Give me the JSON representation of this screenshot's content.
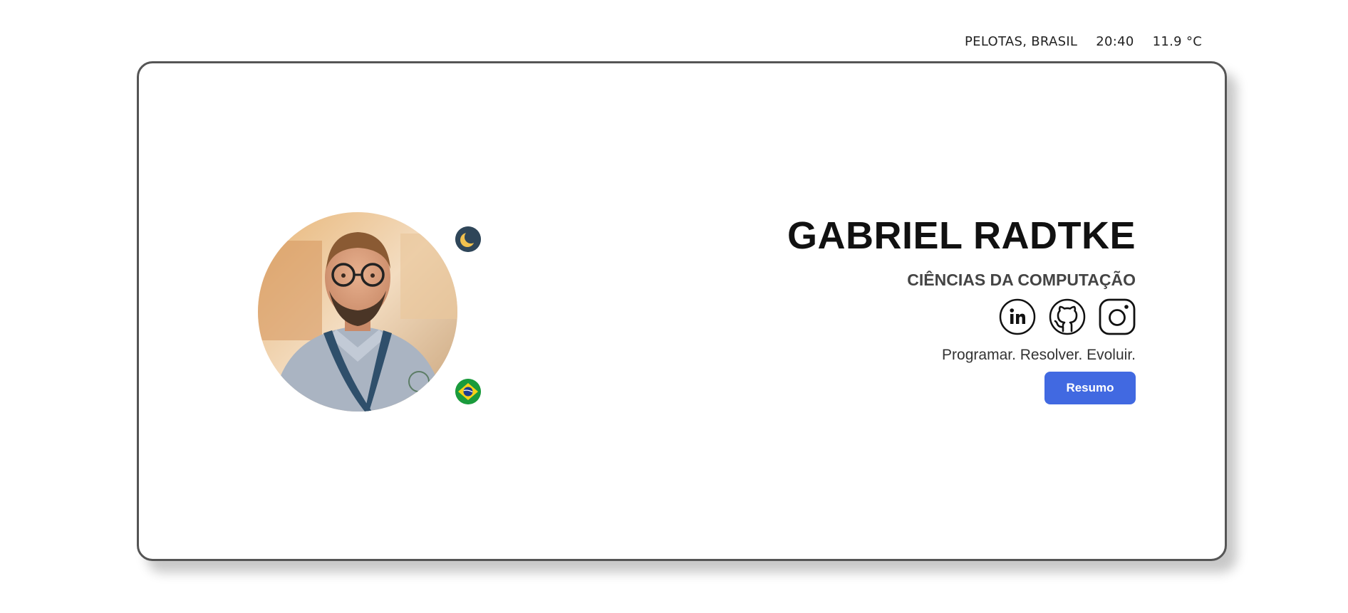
{
  "topbar": {
    "location": "PELOTAS, BRASIL",
    "time": "20:40",
    "temperature": "11.9 °C"
  },
  "profile": {
    "name": "GABRIEL RADTKE",
    "subtitle": "CIÊNCIAS DA COMPUTAÇÃO",
    "tagline": "Programar. Resolver. Evoluir.",
    "resume_label": "Resumo"
  },
  "socials": [
    {
      "icon": "linkedin-icon"
    },
    {
      "icon": "github-icon"
    },
    {
      "icon": "instagram-icon"
    }
  ],
  "colors": {
    "accent": "#4169e1",
    "moon_bg": "#2f4659",
    "flag_green": "#1a9b3c"
  }
}
